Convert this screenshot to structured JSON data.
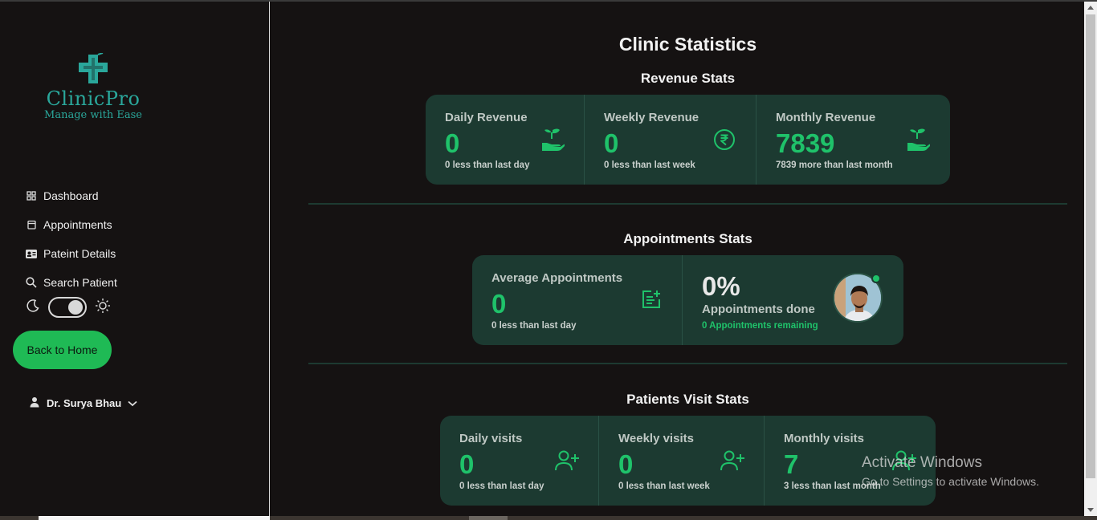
{
  "brand": {
    "name": "ClinicPro",
    "tagline": "Manage with Ease"
  },
  "sidebar": {
    "items": [
      {
        "label": "Dashboard",
        "icon": "grid-icon"
      },
      {
        "label": "Appointments",
        "icon": "calendar-icon"
      },
      {
        "label": "Pateint Details",
        "icon": "id-card-icon"
      },
      {
        "label": "Search Patient",
        "icon": "search-icon"
      }
    ],
    "theme_toggle": {
      "state": "dark-off"
    },
    "back_button": "Back to Home",
    "user": "Dr. Surya Bhau"
  },
  "main": {
    "title": "Clinic Statistics",
    "revenue": {
      "title": "Revenue Stats",
      "stats": [
        {
          "label": "Daily Revenue",
          "value": "0",
          "sub": "0 less than last day",
          "icon": "hand-plant-icon"
        },
        {
          "label": "Weekly Revenue",
          "value": "0",
          "sub": "0 less than last week",
          "icon": "rupee-icon"
        },
        {
          "label": "Monthly Revenue",
          "value": "7839",
          "sub": "7839 more than last month",
          "icon": "hand-plant-icon"
        }
      ]
    },
    "appointments": {
      "title": "Appointments Stats",
      "average": {
        "label": "Average Appointments",
        "value": "0",
        "sub": "0 less than last day",
        "icon": "note-add-icon"
      },
      "done": {
        "percent": "0%",
        "label": "Appointments done",
        "sub": "0 Appointments remaining"
      }
    },
    "visits": {
      "title": "Patients Visit Stats",
      "stats": [
        {
          "label": "Daily visits",
          "value": "0",
          "sub": "0 less than last day",
          "icon": "user-plus-icon"
        },
        {
          "label": "Weekly visits",
          "value": "0",
          "sub": "0 less than last week",
          "icon": "user-plus-icon"
        },
        {
          "label": "Monthly visits",
          "value": "7",
          "sub": "3 less than last month",
          "icon": "user-plus-icon"
        }
      ]
    }
  },
  "watermark": {
    "title": "Activate Windows",
    "subtitle": "Go to Settings to activate Windows."
  },
  "colors": {
    "accent": "#1fc26a",
    "card": "#1c3a31",
    "button": "#1fba55",
    "background": "#151212"
  }
}
